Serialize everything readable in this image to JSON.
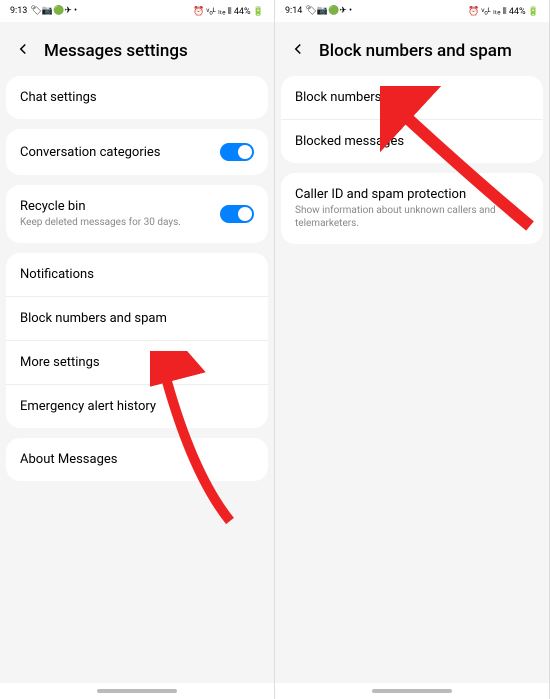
{
  "left": {
    "status": {
      "time": "9:13",
      "icons_left": "🏷📷🟢✈ •",
      "icons_right": "⏰ ᵛₒᴸ ₗₜₑ ⫴ 44% 🔋"
    },
    "title": "Messages settings",
    "card1": [
      {
        "label": "Chat settings"
      }
    ],
    "card2": [
      {
        "label": "Conversation categories",
        "toggle": true
      }
    ],
    "card3": [
      {
        "label": "Recycle bin",
        "sub": "Keep deleted messages for 30 days.",
        "toggle": true
      }
    ],
    "card4": [
      {
        "label": "Notifications"
      },
      {
        "label": "Block numbers and spam"
      },
      {
        "label": "More settings"
      },
      {
        "label": "Emergency alert history"
      }
    ],
    "card5": [
      {
        "label": "About Messages"
      }
    ]
  },
  "right": {
    "status": {
      "time": "9:14",
      "icons_left": "🏷📷🟢✈ •",
      "icons_right": "⏰ ᵛₒᴸ ₗₜₑ ⫴ 44% 🔋"
    },
    "title": "Block numbers and spam",
    "card1": [
      {
        "label": "Block numbers"
      },
      {
        "label": "Blocked messages"
      }
    ],
    "card2": [
      {
        "label": "Caller ID and spam protection",
        "sub": "Show information about unknown callers and telemarketers."
      }
    ]
  }
}
